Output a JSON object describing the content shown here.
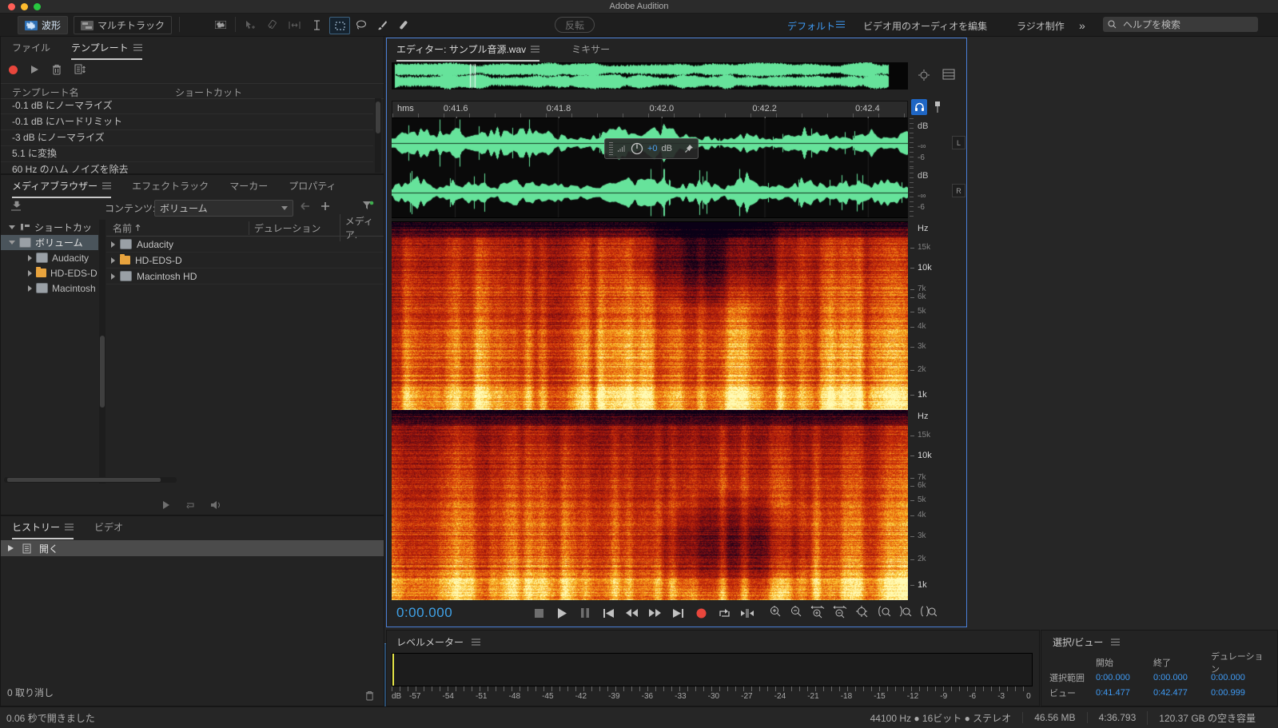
{
  "window": {
    "title": "Adobe Audition"
  },
  "toolbar": {
    "waveform": "波形",
    "multitrack": "マルチトラック",
    "invert": "反転",
    "workspaces": [
      "デフォルト",
      "ビデオ用のオーディオを編集",
      "ラジオ制作"
    ],
    "more": "»",
    "search_placeholder": "ヘルプを検索"
  },
  "files_panel": {
    "tab_files": "ファイル",
    "tab_templates": "テンプレート",
    "col_name": "テンプレート名",
    "col_shortcut": "ショートカット",
    "templates": [
      "-0.1 dB にノーマライズ",
      "-0.1 dB にハードリミット",
      "-3 dB にノーマライズ",
      "5.1 に変換",
      "60 Hz のハム ノイズを除去"
    ]
  },
  "media_browser": {
    "tab_media": "メディアブラウザー",
    "tab_effects": "エフェクトラック",
    "tab_markers": "マーカー",
    "tab_properties": "プロパティ",
    "contents_label": "コンテンツ:",
    "contents_value": "ボリューム",
    "tree": {
      "shortcuts": "ショートカッ",
      "volumes": "ボリューム",
      "children": [
        "Audacity",
        "HD-EDS-D",
        "Macintosh"
      ]
    },
    "col_name": "名前",
    "col_duration": "デュレーション",
    "col_media": "メディア.",
    "rows": [
      "Audacity",
      "HD-EDS-D",
      "Macintosh HD"
    ]
  },
  "history_panel": {
    "tab_history": "ヒストリー",
    "tab_video": "ビデオ",
    "entry_open": "開く",
    "undo_status": "0 取り消し"
  },
  "editor": {
    "tab_editor": "エディター: サンプル音源.wav",
    "tab_mixer": "ミキサー",
    "ruler_unit": "hms",
    "ruler_ticks": [
      "0:41.6",
      "0:41.8",
      "0:42.0",
      "0:42.2",
      "0:42.4"
    ],
    "hud_value": "+0",
    "hud_unit": "dB",
    "db_label": "dB",
    "db_neg_inf": "-∞",
    "db_neg6": "-6",
    "ch_left": "L",
    "ch_right": "R",
    "freq_unit": "Hz",
    "freq_ticks": [
      "15k",
      "10k",
      "7k",
      "6k",
      "5k",
      "4k",
      "3k",
      "2k",
      "1k"
    ],
    "time_display": "0:00.000"
  },
  "level_meter": {
    "title": "レベルメーター",
    "unit": "dB",
    "scale": [
      "-57",
      "-54",
      "-51",
      "-48",
      "-45",
      "-42",
      "-39",
      "-36",
      "-33",
      "-30",
      "-27",
      "-24",
      "-21",
      "-18",
      "-15",
      "-12",
      "-9",
      "-6",
      "-3",
      "0"
    ]
  },
  "selection_view": {
    "title": "選択/ビュー",
    "col_start": "開始",
    "col_end": "終了",
    "col_duration": "デュレーション",
    "row_selection_label": "選択範囲",
    "row_view_label": "ビュー",
    "selection": {
      "start": "0:00.000",
      "end": "0:00.000",
      "duration": "0:00.000"
    },
    "view": {
      "start": "0:41.477",
      "end": "0:42.477",
      "duration": "0:00.999"
    }
  },
  "status_bar": {
    "left": "0.06 秒で開きました",
    "format": "44100 Hz ● 16ビット ● ステレオ",
    "size": "46.56 MB",
    "duration": "4:36.793",
    "free": "120.37 GB の空き容量"
  },
  "colors": {
    "accent_blue": "#3f9bf5",
    "wave_green": "#66e39b",
    "record_red": "#e8463c"
  }
}
